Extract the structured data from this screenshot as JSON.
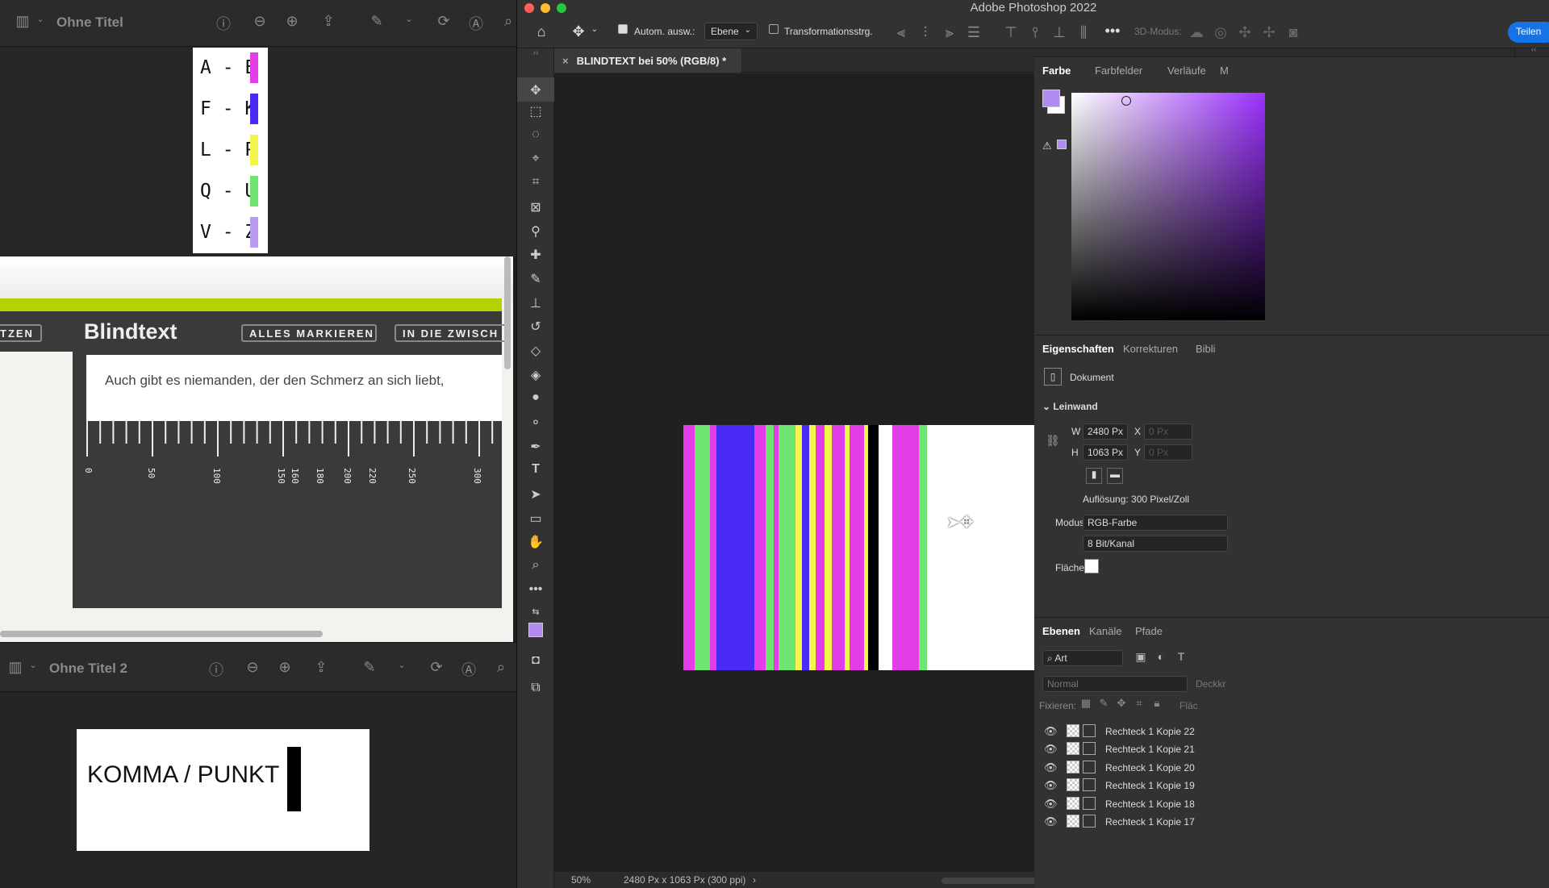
{
  "preview1": {
    "title": "Ohne Titel"
  },
  "legend": [
    {
      "label": "A - E",
      "color": "#e23de6"
    },
    {
      "label": "F - K",
      "color": "#4a2af5"
    },
    {
      "label": "L - P",
      "color": "#f3f54a"
    },
    {
      "label": "Q - U",
      "color": "#6ee572"
    },
    {
      "label": "V - Z",
      "color": "#bb9bf0"
    }
  ],
  "blindtext": {
    "left_pill": "TZEN",
    "title": "Blindtext",
    "select_all": "ALLES MARKIEREN",
    "clipboard": "IN DIE ZWISCH",
    "sample": "Auch gibt es niemanden, der den Schmerz an sich liebt,",
    "ruler_labels": [
      "0",
      "50",
      "100",
      "150",
      "160",
      "180",
      "200",
      "220",
      "250",
      "300"
    ]
  },
  "preview2": {
    "title": "Ohne Titel 2"
  },
  "komma": {
    "label": "KOMMA / PUNKT"
  },
  "photoshop": {
    "app_title": "Adobe Photoshop 2022",
    "options": {
      "auto_select": "Autom. ausw.:",
      "auto_select_target": "Ebene",
      "transform": "Transformationsstrg.",
      "mode3d": "3D-Modus:",
      "share": "Teilen"
    },
    "doc_tab": "BLINDTEXT bei 50% (RGB/8) *",
    "canvas_stripes": [
      {
        "color": "#e23de6"
      },
      {
        "color": "#6ee572"
      },
      {
        "color": "#e23de6"
      },
      {
        "color": "#4a2af5"
      },
      {
        "color": "#e23de6"
      },
      {
        "color": "#6ee572"
      },
      {
        "color": "#e23de6"
      },
      {
        "color": "#6ee572"
      },
      {
        "color": "#f3f54a"
      },
      {
        "color": "#4a2af5"
      },
      {
        "color": "#f3f54a"
      },
      {
        "color": "#e23de6"
      },
      {
        "color": "#f3f54a"
      },
      {
        "color": "#e23de6"
      },
      {
        "color": "#f3f54a"
      },
      {
        "color": "#e23de6"
      },
      {
        "color": "#f3f54a"
      },
      {
        "color": "#000000"
      },
      {
        "color": "#e23de6"
      },
      {
        "color": "#6ee572"
      }
    ],
    "status": {
      "zoom": "50%",
      "size": "2480 Px x 1063 Px (300 ppi)"
    },
    "color_panel": {
      "tabs": [
        "Farbe",
        "Farbfelder",
        "Verläufe",
        "M"
      ],
      "foreground": "#b18cf0",
      "background": "#ffffff"
    },
    "properties": {
      "tabs": [
        "Eigenschaften",
        "Korrekturen",
        "Bibli"
      ],
      "type": "Dokument",
      "section": "Leinwand",
      "w_label": "W",
      "w": "2480 Px",
      "h_label": "H",
      "h": "1063 Px",
      "x_label": "X",
      "x": "0 Px",
      "y_label": "Y",
      "y": "0 Px",
      "resolution": "Auflösung: 300 Pixel/Zoll",
      "mode_label": "Modus",
      "mode": "RGB-Farbe",
      "depth": "8 Bit/Kanal",
      "fill_label": "Fläche"
    },
    "layers": {
      "tabs": [
        "Ebenen",
        "Kanäle",
        "Pfade"
      ],
      "filter": "Art",
      "blend": "Normal",
      "opacity": "Deckkr",
      "lock_label": "Fixieren:",
      "fill": "Fläc",
      "items": [
        "Rechteck 1 Kopie 22",
        "Rechteck 1 Kopie 21",
        "Rechteck 1 Kopie 20",
        "Rechteck 1 Kopie 19",
        "Rechteck 1 Kopie 18",
        "Rechteck 1 Kopie 17"
      ]
    }
  }
}
